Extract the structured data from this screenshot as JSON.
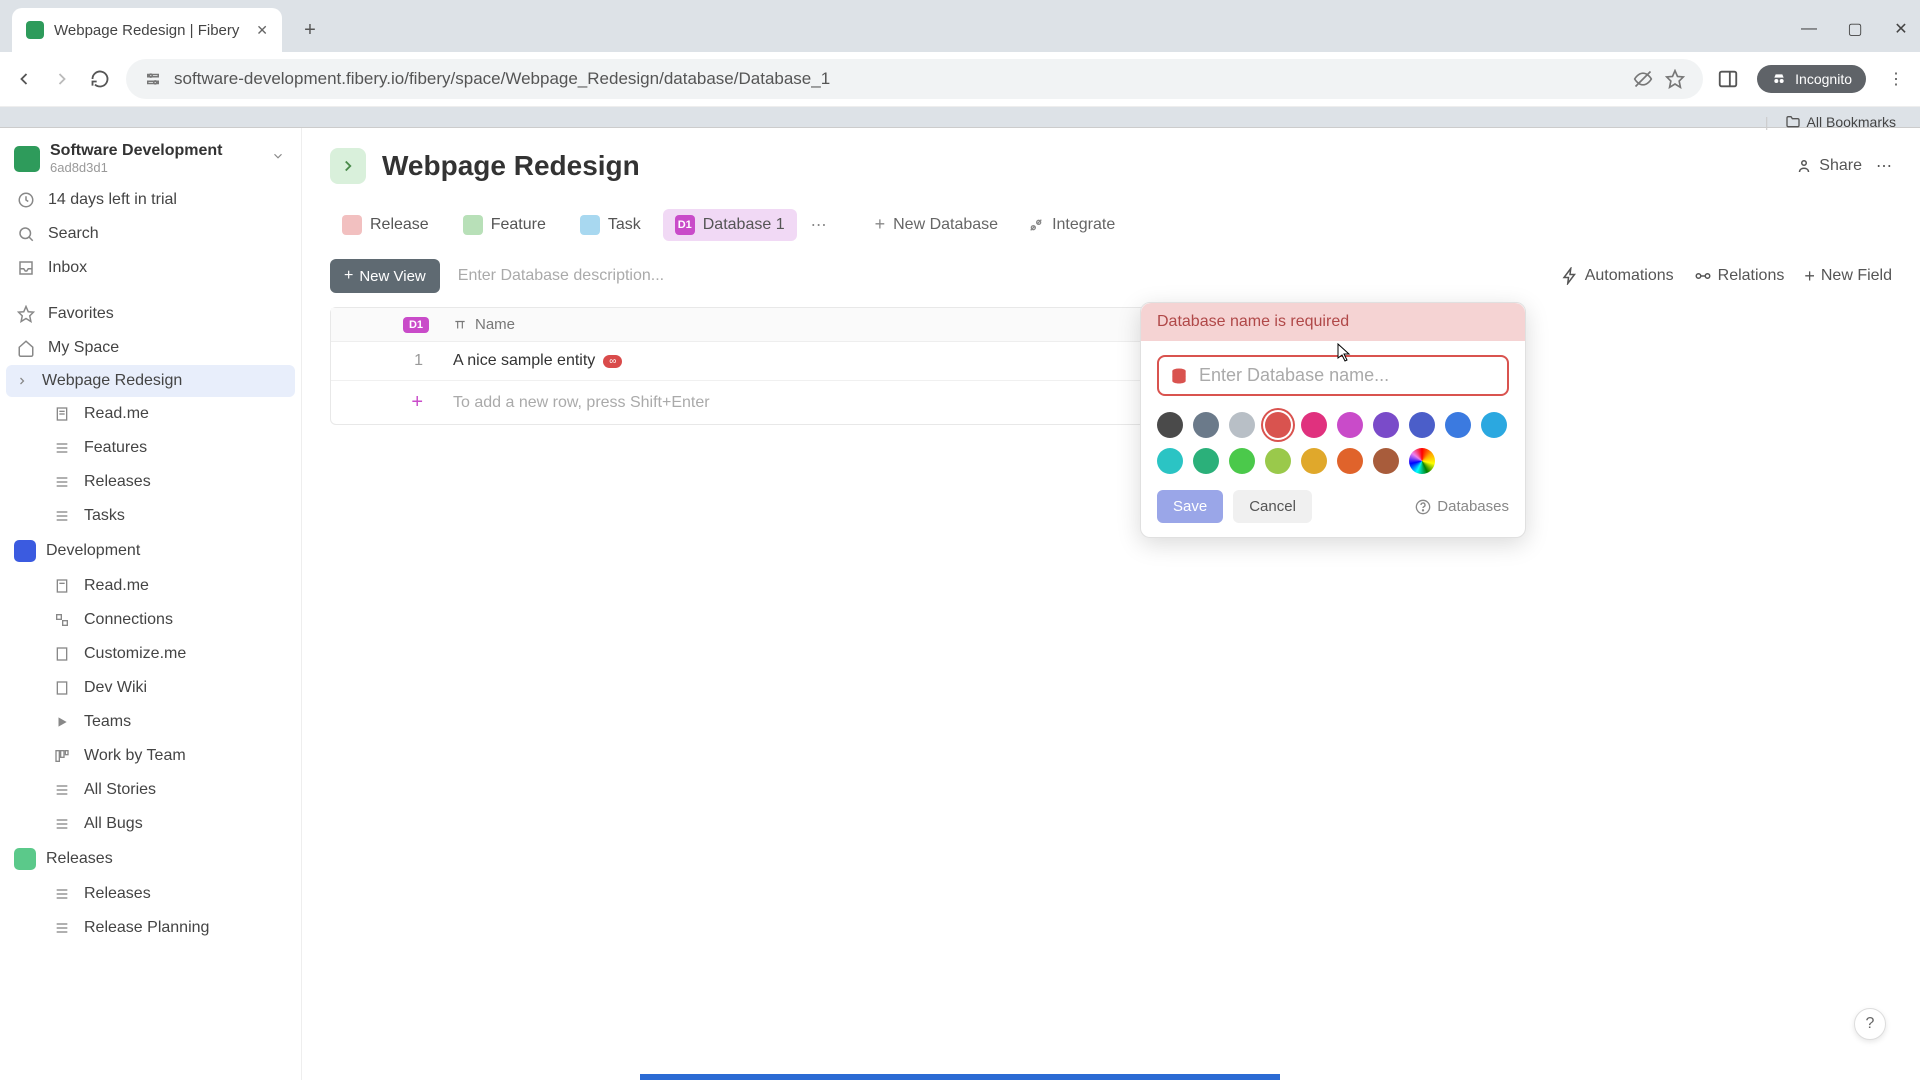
{
  "browser": {
    "tab_title": "Webpage Redesign | Fibery",
    "url": "software-development.fibery.io/fibery/space/Webpage_Redesign/database/Database_1",
    "incognito_label": "Incognito",
    "bookmarks_label": "All Bookmarks"
  },
  "workspace": {
    "name": "Software Development",
    "id": "6ad8d3d1",
    "trial": "14 days left in trial"
  },
  "sidebar": {
    "search": "Search",
    "inbox": "Inbox",
    "favorites": "Favorites",
    "my_space": "My Space",
    "spaces": {
      "webpage_redesign": {
        "label": "Webpage Redesign",
        "items": [
          "Read.me",
          "Features",
          "Releases",
          "Tasks"
        ]
      },
      "development": {
        "label": "Development",
        "items": [
          "Read.me",
          "Connections",
          "Customize.me",
          "Dev Wiki",
          "Teams",
          "Work by Team",
          "All Stories",
          "All Bugs"
        ]
      },
      "releases": {
        "label": "Releases",
        "items": [
          "Releases",
          "Release Planning"
        ]
      }
    }
  },
  "page": {
    "title": "Webpage Redesign",
    "share": "Share",
    "db_tabs": {
      "release": "Release",
      "feature": "Feature",
      "task": "Task",
      "database1": "Database 1",
      "d1_badge": "D1",
      "new_database": "New Database",
      "integrate": "Integrate"
    },
    "toolbar": {
      "new_view": "New View",
      "description_placeholder": "Enter Database description...",
      "automations": "Automations",
      "relations": "Relations",
      "new_field": "New Field"
    },
    "table": {
      "col_name": "Name",
      "row1": {
        "num": "1",
        "text": "A nice sample entity"
      },
      "add_hint": "To add a new row, press Shift+Enter"
    }
  },
  "popup": {
    "error": "Database name is required",
    "placeholder": "Enter Database name...",
    "save": "Save",
    "cancel": "Cancel",
    "databases": "Databases",
    "colors_row1": [
      "#4a4a4a",
      "#6b7a8a",
      "#b8bfc6",
      "#d9534f",
      "#e0317e",
      "#c94bc9",
      "#7a4bc9",
      "#4b5ec9",
      "#3b7ae0"
    ],
    "colors_row2": [
      "#2ba8e0",
      "#2bc4c4",
      "#2bb07a",
      "#4bc94b",
      "#9ac94b",
      "#e0a82b",
      "#e0632b",
      "#a85c3b"
    ]
  }
}
